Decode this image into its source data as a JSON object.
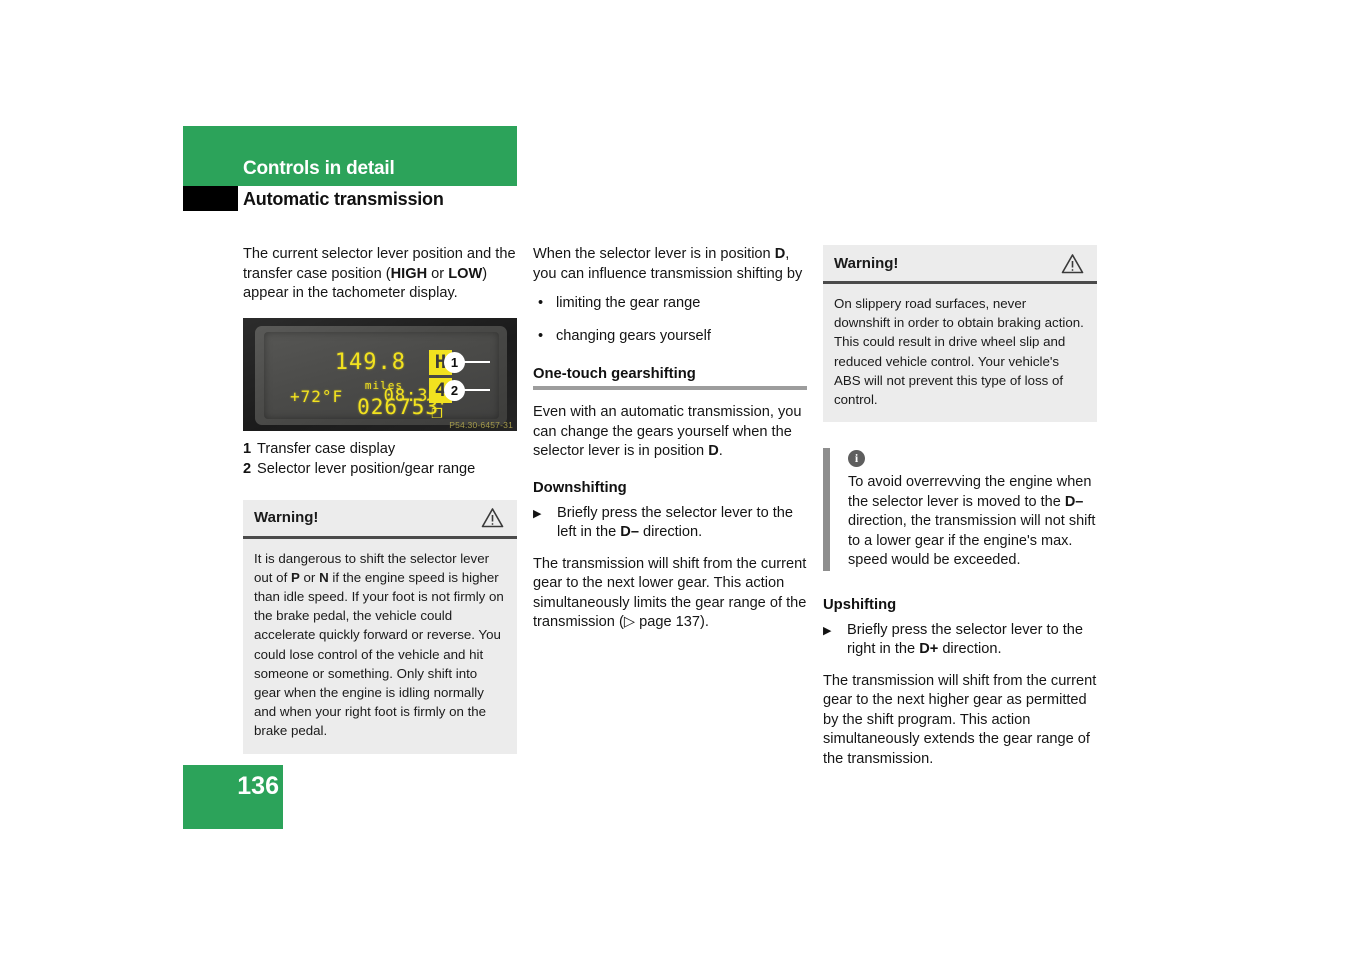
{
  "header": {
    "chapter": "Controls in detail",
    "section": "Automatic transmission"
  },
  "page": {
    "number": "136"
  },
  "column1": {
    "intro_1": "The current selector lever position and the transfer case position (",
    "intro_bold_high": "HIGH",
    "intro_2": " or ",
    "intro_bold_low": "LOW",
    "intro_3": ") appear in the tachometer display.",
    "figure": {
      "speed": "149.8",
      "units": "miles",
      "odometer": "026753",
      "temperature": "+72°F",
      "time": "08:30p",
      "transfer_case_value": "H",
      "gear_range_value": "4",
      "door_icon": "❐",
      "callout_1": "1",
      "callout_2": "2",
      "image_code": "P54.30-6457-31"
    },
    "legend": [
      {
        "num": "1",
        "text": "Transfer case display"
      },
      {
        "num": "2",
        "text": "Selector lever position/gear range"
      }
    ],
    "warning": {
      "title": "Warning!",
      "text_1": "It is dangerous to shift the selector lever out of ",
      "bold_p": "P",
      "text_2": " or ",
      "bold_n": "N",
      "text_3": " if the engine speed is higher than idle speed. If your foot is not firmly on the brake pedal, the vehicle could accelerate quickly forward or reverse. You could lose control of the vehicle and hit someone or something. Only shift into gear when the engine is idling normally and when your right foot is firmly on the brake pedal."
    }
  },
  "column2": {
    "intro_1": "When the selector lever is in position ",
    "intro_bold_d": "D",
    "intro_2": ", you can influence transmission shifting by",
    "bullets": [
      {
        "mark": "•",
        "text": "limiting the gear range"
      },
      {
        "mark": "•",
        "text": "changing gears yourself"
      }
    ],
    "subhead_onetouch": "One-touch gearshifting",
    "onetouch_1": "Even with an automatic transmission, you can change the gears yourself when the selector lever is in position ",
    "onetouch_bold_d": "D",
    "onetouch_2": ".",
    "subhead_downshifting": "Downshifting",
    "downshift_step": {
      "mark": "▶",
      "text_1": "Briefly press the selector lever to the left in the ",
      "bold": "D–",
      "text_2": " direction."
    },
    "downshift_result_1": "The transmission will shift from the current gear to the next lower gear. This action simultaneously limits the gear range of the transmission (",
    "downshift_ref_icon": "▷",
    "downshift_result_2": " page 137)."
  },
  "column3": {
    "warning": {
      "title": "Warning!",
      "text": "On slippery road surfaces, never downshift in order to obtain braking action. This could result in drive wheel slip and reduced vehicle control. Your vehicle's ABS will not prevent this type of loss of control."
    },
    "note": {
      "icon": "i",
      "text_1": "To avoid overrevving the engine when the selector lever is moved to the ",
      "bold": "D–",
      "text_2": " direction, the transmission will not shift to a lower gear if the engine's max. speed would be exceeded."
    },
    "subhead_upshifting": "Upshifting",
    "upshift_step": {
      "mark": "▶",
      "text_1": "Briefly press the selector lever to the right in the ",
      "bold": "D+",
      "text_2": " direction."
    },
    "upshift_result": "The transmission will shift from the current gear to the next higher gear as permitted by the shift program. This action simultaneously extends the gear range of the transmission."
  },
  "colors": {
    "brand_green": "#2ca35a",
    "warning_bg": "#ececec",
    "rule_grey": "#9d9d9d",
    "lcd_yellow": "#f2e21f"
  }
}
